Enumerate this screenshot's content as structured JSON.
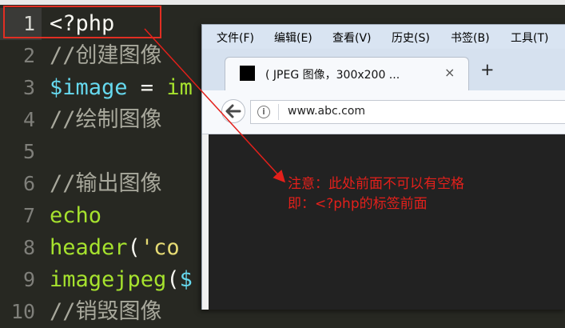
{
  "editor": {
    "lines": [
      {
        "num": "1",
        "tokens": [
          {
            "t": "<?php",
            "c": "tk-white"
          }
        ]
      },
      {
        "num": "2",
        "tokens": [
          {
            "t": "//创建图像",
            "c": "tk-comment"
          }
        ]
      },
      {
        "num": "3",
        "tokens": [
          {
            "t": "$image",
            "c": "tk-blue"
          },
          {
            "t": " = ",
            "c": "tk-white"
          },
          {
            "t": "im",
            "c": "tk-green"
          }
        ]
      },
      {
        "num": "4",
        "tokens": [
          {
            "t": "//绘制图像",
            "c": "tk-comment"
          }
        ]
      },
      {
        "num": "5",
        "tokens": []
      },
      {
        "num": "6",
        "tokens": [
          {
            "t": "//输出图像",
            "c": "tk-comment"
          }
        ]
      },
      {
        "num": "7",
        "tokens": [
          {
            "t": "echo",
            "c": "tk-green"
          }
        ]
      },
      {
        "num": "8",
        "tokens": [
          {
            "t": "header",
            "c": "tk-green"
          },
          {
            "t": "(",
            "c": "tk-white"
          },
          {
            "t": "'co",
            "c": "tk-yellow"
          }
        ]
      },
      {
        "num": "9",
        "tokens": [
          {
            "t": "imagejpeg",
            "c": "tk-green"
          },
          {
            "t": "(",
            "c": "tk-white"
          },
          {
            "t": "$",
            "c": "tk-blue"
          }
        ]
      },
      {
        "num": "10",
        "tokens": [
          {
            "t": "//销毁图像",
            "c": "tk-comment"
          }
        ]
      }
    ]
  },
  "browser": {
    "menu": [
      "文件(F)",
      "编辑(E)",
      "查看(V)",
      "历史(S)",
      "书签(B)",
      "工具(T)"
    ],
    "tab_title": "( JPEG 图像，300x200 ...",
    "tab_close": "×",
    "new_tab": "+",
    "url": "www.abc.com",
    "info_glyph": "i"
  },
  "annotation": {
    "line1": "注意：此处前面不可以有空格",
    "line2": "即：<?php的标签前面",
    "color": "#e3201b"
  }
}
